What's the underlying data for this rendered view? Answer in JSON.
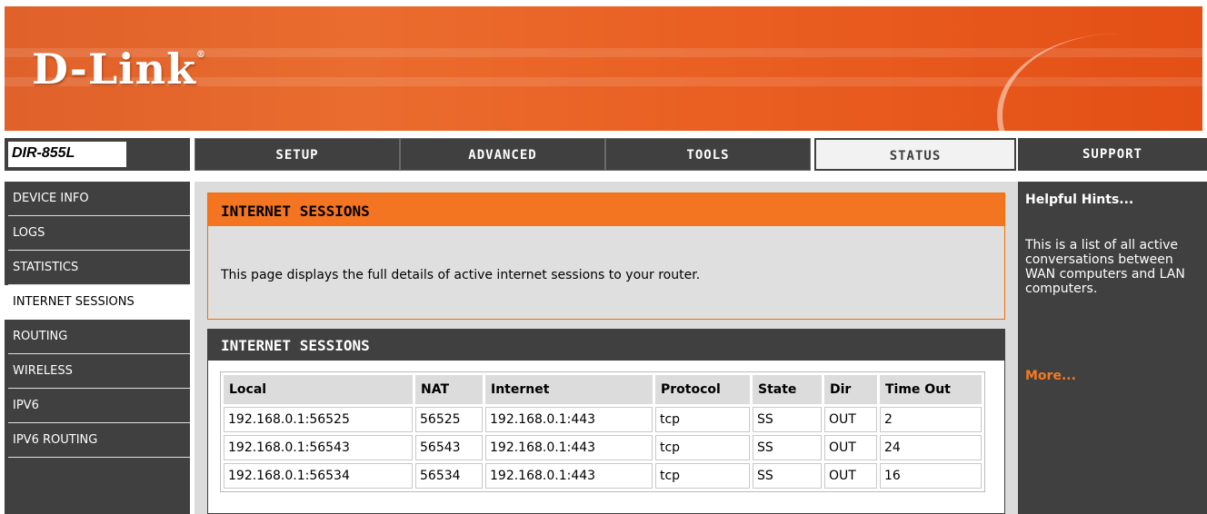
{
  "brand": {
    "logo_text": "D-Link",
    "trademark": "®"
  },
  "model": {
    "name": "DIR-855L",
    "slashes": "///"
  },
  "nav": {
    "tabs": [
      {
        "label": "SETUP"
      },
      {
        "label": "ADVANCED"
      },
      {
        "label": "TOOLS"
      },
      {
        "label": "STATUS"
      }
    ],
    "support_label": "SUPPORT"
  },
  "sidebar": {
    "items": [
      {
        "label": "DEVICE INFO"
      },
      {
        "label": "LOGS"
      },
      {
        "label": "STATISTICS"
      },
      {
        "label": "INTERNET SESSIONS"
      },
      {
        "label": "ROUTING"
      },
      {
        "label": "WIRELESS"
      },
      {
        "label": "IPV6"
      },
      {
        "label": "IPV6 ROUTING"
      }
    ]
  },
  "intro": {
    "heading": "INTERNET SESSIONS",
    "text": "This page displays the full details of active internet sessions to your router."
  },
  "sessions": {
    "heading": "INTERNET SESSIONS",
    "columns": [
      "Local",
      "NAT",
      "Internet",
      "Protocol",
      "State",
      "Dir",
      "Time Out"
    ],
    "rows": [
      [
        "192.168.0.1:56525",
        "56525",
        "192.168.0.1:443",
        "tcp",
        "SS",
        "OUT",
        "2"
      ],
      [
        "192.168.0.1:56543",
        "56543",
        "192.168.0.1:443",
        "tcp",
        "SS",
        "OUT",
        "24"
      ],
      [
        "192.168.0.1:56534",
        "56534",
        "192.168.0.1:443",
        "tcp",
        "SS",
        "OUT",
        "16"
      ]
    ]
  },
  "hints": {
    "title": "Helpful Hints...",
    "text": "This is a list of all active conversations between WAN computers and LAN computers.",
    "more": "More..."
  },
  "colors": {
    "orange": "#f37421",
    "dark": "#404040",
    "panel": "#dcdcdc"
  }
}
